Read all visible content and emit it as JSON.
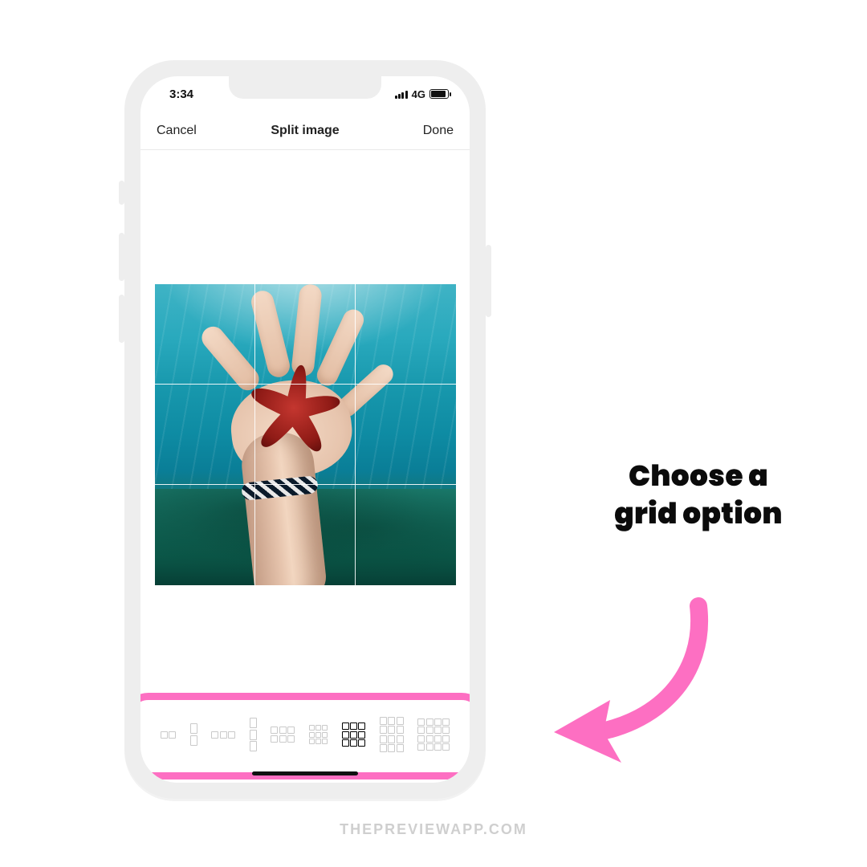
{
  "statusBar": {
    "time": "3:34",
    "network": "4G"
  },
  "navBar": {
    "cancel": "Cancel",
    "title": "Split image",
    "done": "Done"
  },
  "annotation": {
    "line1": "Choose a",
    "line2": "grid option"
  },
  "watermark": "THEPREVIEWAPP.COM",
  "colors": {
    "highlight": "#fd6fc2"
  },
  "gridOptions": [
    {
      "name": "grid-1x2",
      "rows": 1,
      "cols": 2,
      "selected": false
    },
    {
      "name": "grid-2x1",
      "rows": 2,
      "cols": 1,
      "selected": false
    },
    {
      "name": "grid-1x3",
      "rows": 1,
      "cols": 3,
      "selected": false
    },
    {
      "name": "grid-3x1",
      "rows": 3,
      "cols": 1,
      "selected": false
    },
    {
      "name": "grid-2x3",
      "rows": 2,
      "cols": 3,
      "selected": false
    },
    {
      "name": "grid-3x3-small",
      "rows": 3,
      "cols": 3,
      "selected": false
    },
    {
      "name": "grid-3x3",
      "rows": 3,
      "cols": 3,
      "selected": true
    },
    {
      "name": "grid-4x3",
      "rows": 4,
      "cols": 3,
      "selected": false
    },
    {
      "name": "grid-4x4",
      "rows": 4,
      "cols": 4,
      "selected": false
    }
  ]
}
